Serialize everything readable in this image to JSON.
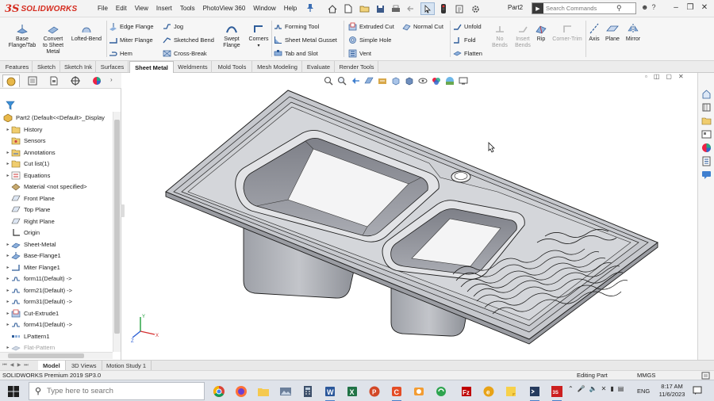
{
  "app": {
    "logo_prefix": "3S",
    "logo_text": "SOLIDWORKS",
    "menus": [
      "File",
      "Edit",
      "View",
      "Insert",
      "Tools",
      "PhotoView 360",
      "Window",
      "Help"
    ],
    "document_name": "Part2",
    "search_placeholder": "Search Commands",
    "help_label": "?"
  },
  "ribbon": {
    "base_flange": "Base\nFlange/Tab",
    "convert_sheet": "Convert\nto Sheet\nMetal",
    "lofted_bend": "Lofted-Bend",
    "edge_flange": "Edge Flange",
    "miter_flange": "Miter Flange",
    "hem": "Hem",
    "jog": "Jog",
    "sketched_bend": "Sketched Bend",
    "cross_break": "Cross-Break",
    "swept_flange": "Swept\nFlange",
    "corners": "Corners",
    "forming_tool": "Forming Tool",
    "sheet_metal_gusset": "Sheet Metal Gusset",
    "tab_and_slot": "Tab and Slot",
    "extruded_cut": "Extruded Cut",
    "simple_hole": "Simple Hole",
    "vent": "Vent",
    "normal_cut": "Normal Cut",
    "unfold": "Unfold",
    "fold": "Fold",
    "flatten": "Flatten",
    "no_bends": "No\nBends",
    "insert_bends": "Insert\nBends",
    "rip": "Rip",
    "corner_trim": "Corner-Trim",
    "axis": "Axis",
    "plane": "Plane",
    "mirror": "Mirror"
  },
  "tabs": [
    "Features",
    "Sketch",
    "Sketch Ink",
    "Surfaces",
    "Sheet Metal",
    "Weldments",
    "Mold Tools",
    "Mesh Modeling",
    "Evaluate",
    "Render Tools"
  ],
  "active_tab": "Sheet Metal",
  "tree": {
    "root": "Part2  (Default<<Default>_Display",
    "items": [
      "History",
      "Sensors",
      "Annotations",
      "Cut list(1)",
      "Equations",
      "Material <not specified>",
      "Front Plane",
      "Top Plane",
      "Right Plane",
      "Origin",
      "Sheet-Metal",
      "Base-Flange1",
      "Miter Flange1",
      "form11(Default) ->",
      "form21(Default) ->",
      "form31(Default) ->",
      "Cut-Extrude1",
      "form41(Default) ->",
      "LPattern1",
      "Flat-Pattern"
    ]
  },
  "triad": {
    "x": "X",
    "y": "Y",
    "z": "Z"
  },
  "bottom_tabs": [
    "Model",
    "3D Views",
    "Motion Study 1"
  ],
  "status": {
    "version": "SOLIDWORKS Premium 2019 SP3.0",
    "mode": "Editing Part",
    "units": "MMGS"
  },
  "taskbar": {
    "search_placeholder": "Type here to search",
    "language": "ENG",
    "time": "8:17 AM",
    "date": "11/6/2023"
  },
  "colors": {
    "brand_red": "#d52b1e",
    "accent_blue": "#2f6db5",
    "model_gray": "#b9bcc2"
  }
}
